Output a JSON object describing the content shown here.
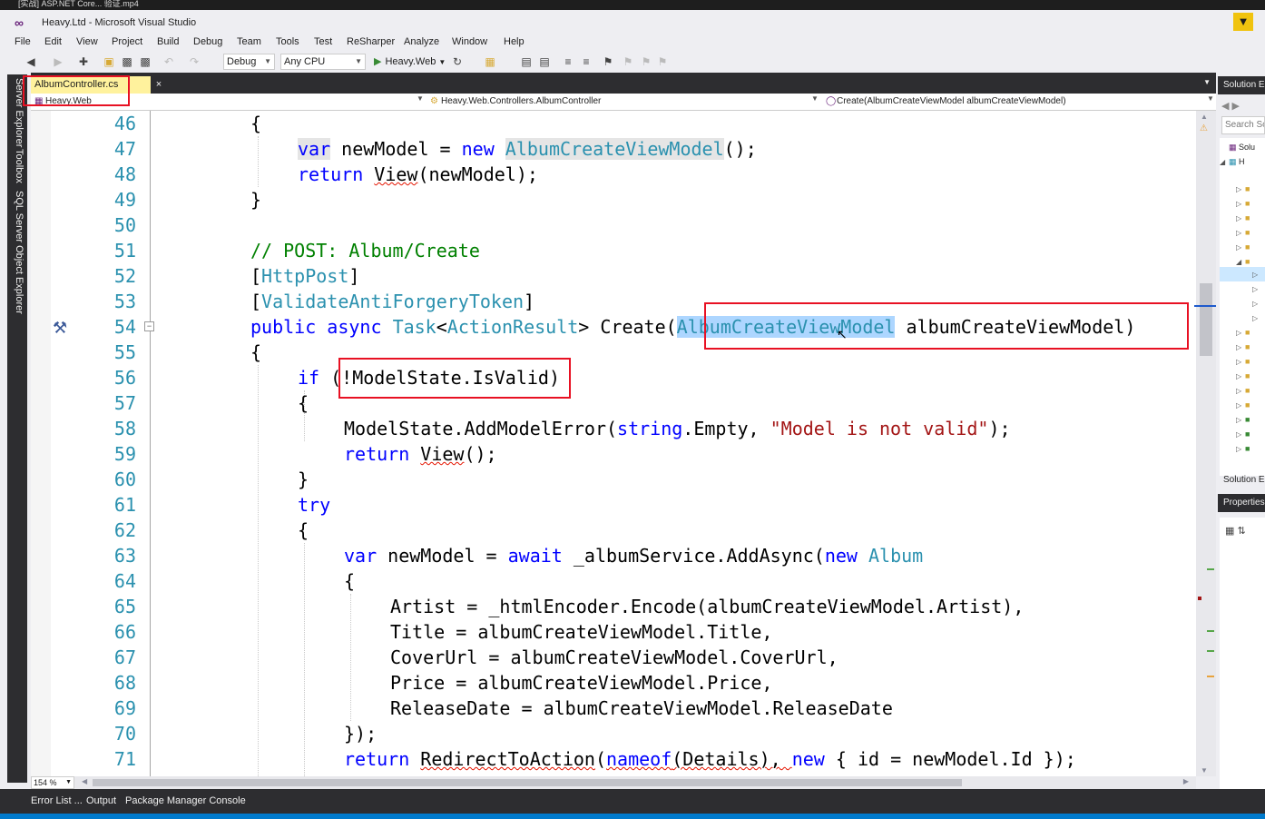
{
  "topbar": {
    "text": "[实战] ASP.NET Core... 验证.mp4"
  },
  "window": {
    "title": "Heavy.Ltd - Microsoft Visual Studio",
    "logo": "vs-logo"
  },
  "menu": [
    "File",
    "Edit",
    "View",
    "Project",
    "Build",
    "Debug",
    "Team",
    "Tools",
    "Test",
    "ReSharper",
    "Analyze",
    "Window",
    "Help"
  ],
  "toolbar": {
    "config": "Debug",
    "platform": "Any CPU",
    "run_target": "Heavy.Web"
  },
  "left_tabs": [
    "Server Explorer",
    "Toolbox",
    "SQL Server Object Explorer"
  ],
  "editor_tab": {
    "name": "AlbumController.cs",
    "pin": "⇤",
    "close": "×"
  },
  "navbar": {
    "project": "Heavy.Web",
    "class": "Heavy.Web.Controllers.AlbumController",
    "member": "Create(AlbumCreateViewModel albumCreateViewModel)"
  },
  "line_numbers": [
    "46",
    "47",
    "48",
    "49",
    "50",
    "51",
    "52",
    "53",
    "54",
    "55",
    "56",
    "57",
    "58",
    "59",
    "60",
    "61",
    "62",
    "63",
    "64",
    "65",
    "66",
    "67",
    "68",
    "69",
    "70",
    "71"
  ],
  "code": {
    "l46": {
      "a": "{"
    },
    "l47": {
      "a": "var",
      "b": " newModel = ",
      "c": "new",
      "d": " ",
      "e": "AlbumCreateViewModel",
      "f": "();"
    },
    "l48": {
      "a": "return",
      "b": " ",
      "c": "View",
      "d": "(newModel);"
    },
    "l49": {
      "a": "}"
    },
    "l51": {
      "a": "// POST: Album/Create"
    },
    "l52": {
      "a": "[",
      "b": "HttpPost",
      "c": "]"
    },
    "l53": {
      "a": "[",
      "b": "ValidateAntiForgeryToken",
      "c": "]"
    },
    "l54": {
      "a": "public",
      "b": " ",
      "c": "async",
      "d": " ",
      "e": "Task",
      "f": "<",
      "g": "ActionResult",
      "h": "> Create(",
      "i": "AlbumCreateViewModel",
      "j": " albumCreateViewModel)"
    },
    "l55": {
      "a": "{"
    },
    "l56": {
      "a": "if",
      "b": " (!ModelState.IsValid)"
    },
    "l57": {
      "a": "{"
    },
    "l58": {
      "a": "ModelState.AddModelError(",
      "b": "string",
      "c": ".Empty, ",
      "d": "\"Model is not valid\"",
      "e": ");"
    },
    "l59": {
      "a": "return",
      "b": " ",
      "c": "View",
      "d": "();"
    },
    "l60": {
      "a": "}"
    },
    "l61": {
      "a": "try"
    },
    "l62": {
      "a": "{"
    },
    "l63": {
      "a": "var",
      "b": " newModel = ",
      "c": "await",
      "d": " _albumService.AddAsync(",
      "e": "new",
      "f": " ",
      "g": "Album"
    },
    "l64": {
      "a": "{"
    },
    "l65": {
      "a": "Artist = _htmlEncoder.Encode(albumCreateViewModel.Artist),"
    },
    "l66": {
      "a": "Title = albumCreateViewModel.Title,"
    },
    "l67": {
      "a": "CoverUrl = albumCreateViewModel.CoverUrl,"
    },
    "l68": {
      "a": "Price = albumCreateViewModel.Price,"
    },
    "l69": {
      "a": "ReleaseDate = albumCreateViewModel.ReleaseDate"
    },
    "l70": {
      "a": "});"
    },
    "l71": {
      "a": "return",
      "b": " ",
      "c": "RedirectToAction",
      "d": "(",
      "e": "nameof",
      "f": "(Details), ",
      "g": "new",
      "h": " { id = newModel.Id });"
    }
  },
  "zoom": "154 %",
  "bottom_tabs": [
    "Error List ...",
    "Output",
    "Package Manager Console"
  ],
  "solution_explorer": {
    "header": "Solution E",
    "search": "Search So",
    "root": "Solu",
    "project": "H",
    "footer": "Solution E"
  },
  "properties": {
    "header": "Properties"
  },
  "colors": {
    "keyword": "#0000ff",
    "type": "#2b91af",
    "comment": "#008000",
    "string": "#a31515",
    "highlight": "#add6ff",
    "annotation": "#e81123"
  }
}
